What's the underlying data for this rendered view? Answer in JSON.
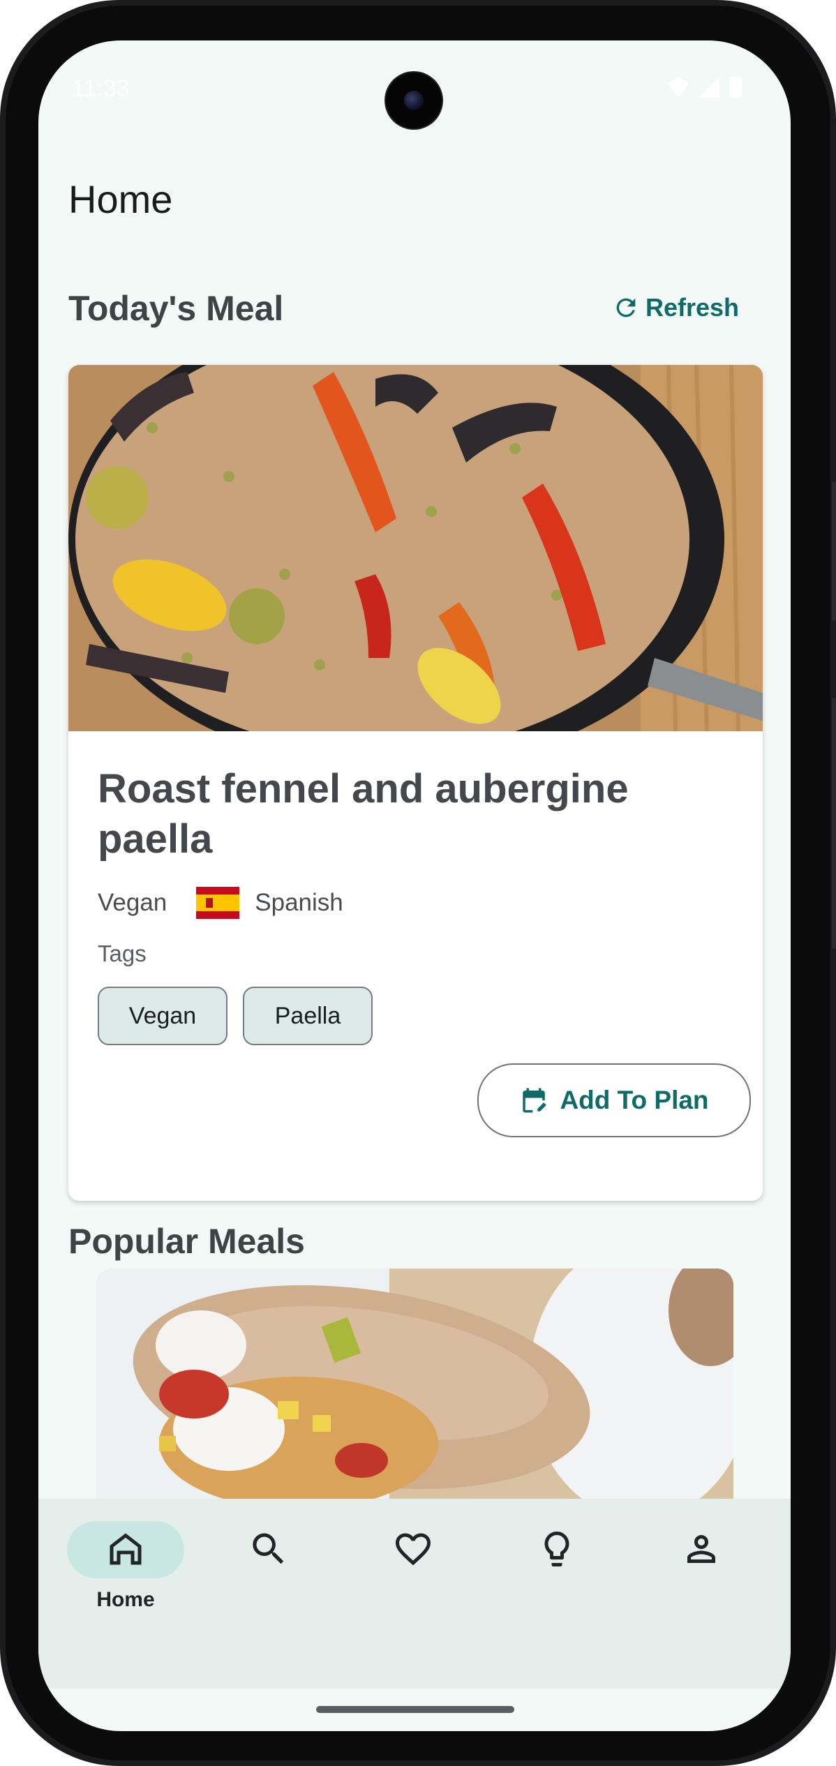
{
  "status_bar": {
    "time": "11:33"
  },
  "page": {
    "title": "Home"
  },
  "todays_meal": {
    "section_title": "Today's Meal",
    "refresh_label": "Refresh",
    "meal": {
      "name": "Roast fennel and aubergine paella",
      "category": "Vegan",
      "cuisine": "Spanish",
      "tags_label": "Tags",
      "tags": [
        "Vegan",
        "Paella"
      ],
      "add_to_plan_label": "Add To Plan"
    }
  },
  "popular_meals": {
    "section_title": "Popular Meals"
  },
  "bottom_nav": {
    "items": [
      {
        "label": "Home",
        "icon": "home-icon",
        "active": true
      },
      {
        "label": "",
        "icon": "search-icon",
        "active": false
      },
      {
        "label": "",
        "icon": "heart-icon",
        "active": false
      },
      {
        "label": "",
        "icon": "lightbulb-icon",
        "active": false
      },
      {
        "label": "",
        "icon": "account-icon",
        "active": false
      }
    ]
  },
  "colors": {
    "accent": "#0f6b67",
    "background": "#f3f9f7",
    "nav_background": "#e6eeec",
    "active_pill": "#c9e7e2",
    "chip_background": "#dcebe8"
  }
}
